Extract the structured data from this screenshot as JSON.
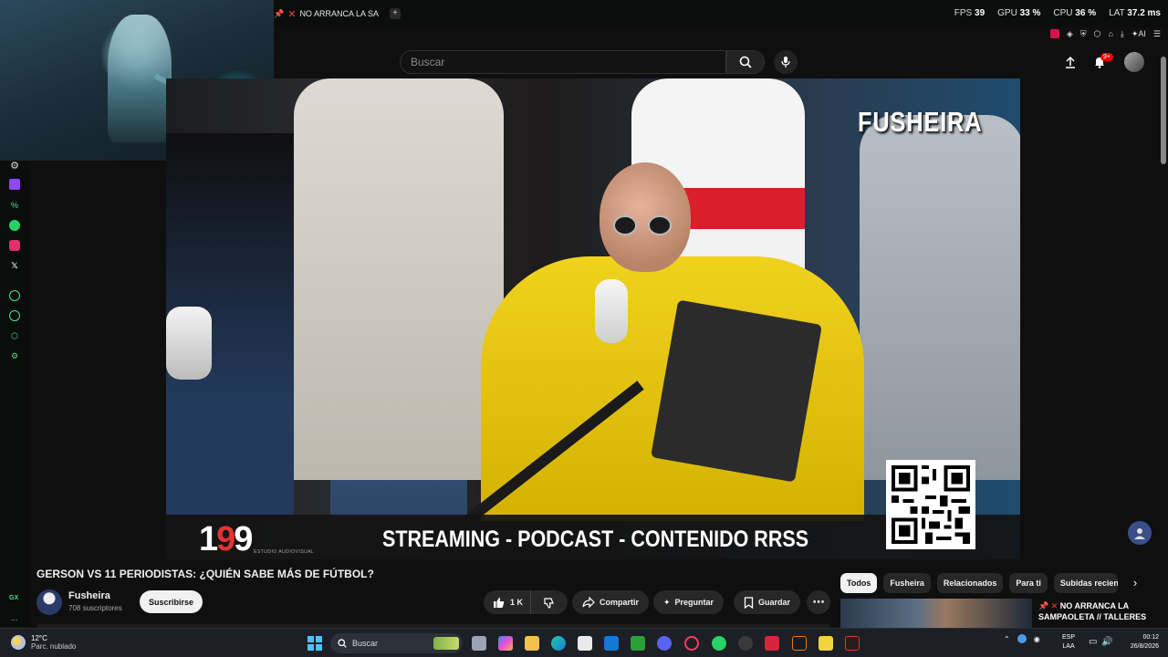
{
  "browser": {
    "tab_title": "NO ARRANCA LA SA",
    "tab_close": "✕",
    "stats": {
      "fps_label": "FPS",
      "fps": "39",
      "gpu_label": "GPU",
      "gpu": "33 %",
      "cpu_label": "CPU",
      "cpu": "36 %",
      "lat_label": "LAT",
      "lat": "37.2 ms"
    },
    "ai_label": "AI"
  },
  "header": {
    "search_placeholder": "Buscar",
    "notifications_badge": "9+"
  },
  "video": {
    "overlay_brand": "FUSHEIRA",
    "banner_logo_1": "1",
    "banner_logo_9": "9",
    "banner_logo_rest": "9",
    "banner_logo_sub": "ESTUDIO AUDIOVISUAL",
    "banner_text": "STREAMING - PODCAST - CONTENIDO RRSS",
    "title": "GERSON VS 11 PERIODISTAS: ¿QUIÉN SABE MÁS DE FÚTBOL?"
  },
  "channel": {
    "name": "Fusheira",
    "subscribers": "708 suscriptores",
    "subscribe_label": "Suscribirse"
  },
  "actions": {
    "likes": "1 K",
    "share": "Compartir",
    "ask": "Preguntar",
    "save": "Guardar",
    "more": "⋯"
  },
  "chips": [
    "Todos",
    "Fusheira",
    "Relacionados",
    "Para ti",
    "Subidas recien"
  ],
  "recommended": {
    "title_prefix": "✕",
    "title": "NO ARRANCA LA SAMPAOLETA // TALLERES"
  },
  "sidebar": {
    "gx_label": "GX",
    "more_label": "..."
  },
  "taskbar": {
    "temp": "12°C",
    "weather_desc": "Parc. nublado",
    "search_label": "Buscar",
    "lang_1": "ESP",
    "lang_2": "LAA",
    "time": "00:12",
    "date": "26/8/2026"
  },
  "colors": {
    "accent_red": "#e3342f",
    "opera_gx_green": "#4ee08a",
    "windows_blue": "#4cc2ff"
  }
}
